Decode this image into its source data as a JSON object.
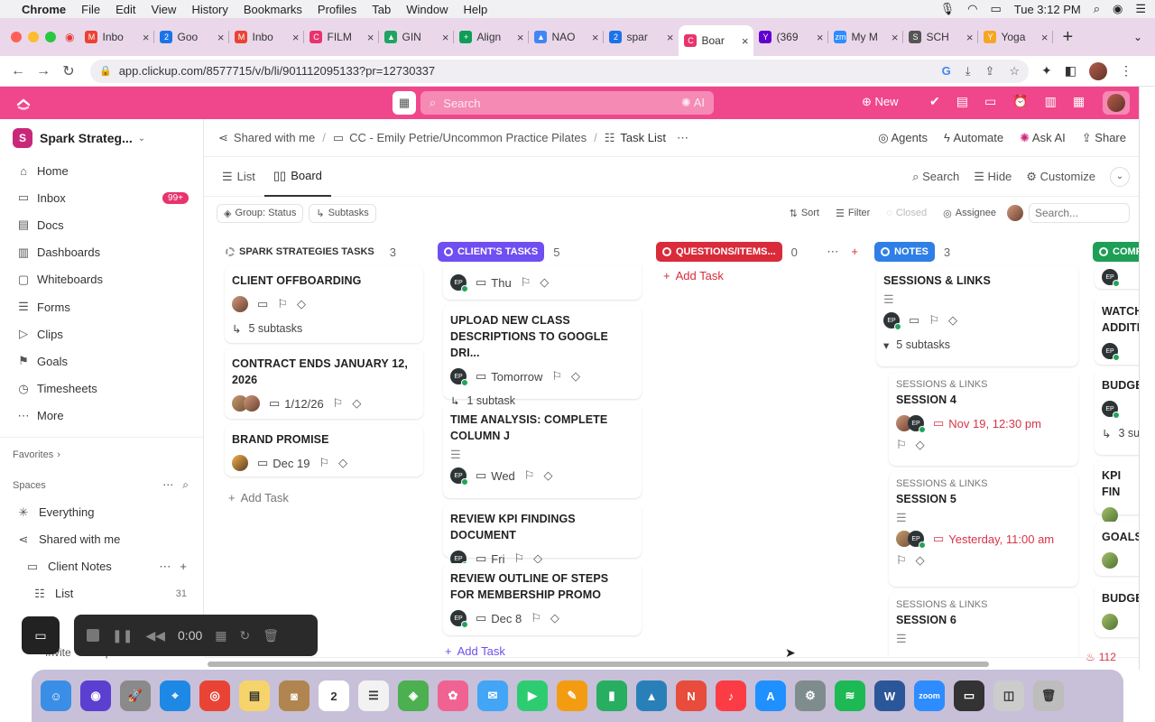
{
  "menubar": {
    "items": [
      "Chrome",
      "File",
      "Edit",
      "View",
      "History",
      "Bookmarks",
      "Profiles",
      "Tab",
      "Window",
      "Help"
    ],
    "clock": "Tue 3:12 PM"
  },
  "tabs": [
    {
      "label": "Inbo",
      "fav": "M",
      "color": "#ea4335"
    },
    {
      "label": "Goo",
      "fav": "2",
      "color": "#1a73e8"
    },
    {
      "label": "Inbo",
      "fav": "M",
      "color": "#ea4335"
    },
    {
      "label": "FILM",
      "fav": "C",
      "color": "#e8336e"
    },
    {
      "label": "GIN",
      "fav": "▲",
      "color": "#1fa463"
    },
    {
      "label": "Align",
      "fav": "+",
      "color": "#0f9d58"
    },
    {
      "label": "NAO",
      "fav": "▲",
      "color": "#4285f4"
    },
    {
      "label": "spar",
      "fav": "2",
      "color": "#1a73e8"
    },
    {
      "label": "Boar",
      "fav": "C",
      "color": "#e8336e"
    },
    {
      "label": "(369",
      "fav": "Y",
      "color": "#6001d2"
    },
    {
      "label": "My M",
      "fav": "zm",
      "color": "#2d8cff"
    },
    {
      "label": "SCH",
      "fav": "S",
      "color": "#555555"
    },
    {
      "label": "Yoga",
      "fav": "Y",
      "color": "#f5a623"
    }
  ],
  "address": {
    "url": "app.clickup.com/8577715/v/b/li/901112095133?pr=12730337"
  },
  "clickup_header": {
    "search_placeholder": "Search",
    "ai_label": "AI",
    "new_label": "New",
    "accent": "#f0478c"
  },
  "sidebar": {
    "workspace_initial": "S",
    "workspace_name": "Spark Strateg...",
    "nav": [
      {
        "label": "Home",
        "icon": "home-icon",
        "glyph": "⌂"
      },
      {
        "label": "Inbox",
        "icon": "inbox-icon",
        "glyph": "▭",
        "count": "99+"
      },
      {
        "label": "Docs",
        "icon": "docs-icon",
        "glyph": "▤"
      },
      {
        "label": "Dashboards",
        "icon": "dashboards-icon",
        "glyph": "▥"
      },
      {
        "label": "Whiteboards",
        "icon": "whiteboards-icon",
        "glyph": "▢"
      },
      {
        "label": "Forms",
        "icon": "forms-icon",
        "glyph": "☰"
      },
      {
        "label": "Clips",
        "icon": "clips-icon",
        "glyph": "▷"
      },
      {
        "label": "Goals",
        "icon": "goals-icon",
        "glyph": "⚑"
      },
      {
        "label": "Timesheets",
        "icon": "timesheets-icon",
        "glyph": "◷"
      },
      {
        "label": "More",
        "icon": "more-icon",
        "glyph": "⋯"
      }
    ],
    "favorites_label": "Favorites",
    "spaces_label": "Spaces",
    "everything_label": "Everything",
    "shared_label": "Shared with me",
    "folder_label": "Client Notes",
    "list_label": "List",
    "list_count": "31",
    "footer_invite": "Invite",
    "footer_help": "Help"
  },
  "breadcrumb": {
    "shared": "Shared with me",
    "folder": "CC - Emily Petrie/Uncommon Practice Pilates",
    "list": "Task List",
    "agents": "Agents",
    "automate": "Automate",
    "ask_ai": "Ask AI",
    "share": "Share"
  },
  "views": {
    "list": "List",
    "board": "Board",
    "search": "Search",
    "hide": "Hide",
    "customize": "Customize"
  },
  "filters": {
    "group": "Group: Status",
    "subtasks": "Subtasks",
    "sort": "Sort",
    "filter": "Filter",
    "closed": "Closed",
    "assignee": "Assignee",
    "search_placeholder": "Search..."
  },
  "columns": [
    {
      "name": "SPARK STRATEGIES TASKS",
      "count": "3",
      "color": "#e9e9e9",
      "pill": "#f0f0f0",
      "text": "#333333"
    },
    {
      "name": "CLIENT'S TASKS",
      "count": "5",
      "color": "#eeeaf8",
      "pill": "#6f4ef2",
      "text": "#ffffff"
    },
    {
      "name": "QUESTIONS/ITEMS...",
      "count": "0",
      "color": "#fbecec",
      "pill": "#d92b3a",
      "text": "#ffffff"
    },
    {
      "name": "NOTES",
      "count": "3",
      "color": "#e9f1fb",
      "pill": "#2f7fe6",
      "text": "#ffffff"
    },
    {
      "name": "COMP",
      "count": "",
      "color": "#eaf6ee",
      "pill": "#1e9e56",
      "text": "#ffffff"
    }
  ],
  "add_task": "Add Task",
  "cards": {
    "c1": {
      "title": "CLIENT OFFBOARDING",
      "sub": "5 subtasks"
    },
    "c2": {
      "title": "CONTRACT ENDS JANUARY 12, 2026",
      "date": "1/12/26"
    },
    "c3": {
      "title": "BRAND PROMISE",
      "date": "Dec 19"
    },
    "d0": {
      "date": "Thu"
    },
    "d1": {
      "title": "UPLOAD NEW CLASS DESCRIPTIONS TO GOOGLE DRI...",
      "date": "Tomorrow",
      "sub": "1 subtask"
    },
    "d2": {
      "title": "TIME ANALYSIS: COMPLETE COLUMN J",
      "date": "Wed"
    },
    "d3": {
      "title": "REVIEW KPI FINDINGS DOCUMENT",
      "date": "Fri"
    },
    "d4": {
      "title": "REVIEW OUTLINE OF STEPS FOR MEMBERSHIP PROMO",
      "date": "Dec 8"
    },
    "n1": {
      "title": "SESSIONS & LINKS",
      "sub": "5 subtasks"
    },
    "n2": {
      "parent": "SESSIONS & LINKS",
      "title": "SESSION 4",
      "date": "Nov 19, 12:30 pm"
    },
    "n3": {
      "parent": "SESSIONS & LINKS",
      "title": "SESSION 5",
      "date": "Yesterday, 11:00 am"
    },
    "n4": {
      "parent": "SESSIONS & LINKS",
      "title": "SESSION 6"
    },
    "e1": {
      "title": "WATCH ADDITI"
    },
    "e2": {
      "title": "BUDGE",
      "sub": "3 su"
    },
    "e3": {
      "title": "KPI FIN"
    },
    "e4": {
      "title": "GOALS"
    },
    "e5": {
      "title": "BUDGE"
    }
  },
  "assignee_initials": "EP",
  "recorder": {
    "time": "0:00"
  },
  "notifications": {
    "count": "112"
  },
  "dock": [
    {
      "name": "finder",
      "glyph": "☺",
      "color": "#3a8ee6"
    },
    {
      "name": "siri",
      "glyph": "◉",
      "color": "#5b3fd1"
    },
    {
      "name": "launchpad",
      "glyph": "🚀",
      "color": "#8a8a8a"
    },
    {
      "name": "safari",
      "glyph": "⌖",
      "color": "#1e88e5"
    },
    {
      "name": "chrome",
      "glyph": "◎",
      "color": "#e94335"
    },
    {
      "name": "notes",
      "glyph": "▤",
      "color": "#f6d46b"
    },
    {
      "name": "contacts",
      "glyph": "◙",
      "color": "#b08550"
    },
    {
      "name": "calendar",
      "glyph": "2",
      "color": "#ffffff"
    },
    {
      "name": "reminders",
      "glyph": "☰",
      "color": "#f2f2f2"
    },
    {
      "name": "maps",
      "glyph": "◈",
      "color": "#4caf50"
    },
    {
      "name": "photos",
      "glyph": "✿",
      "color": "#f06292"
    },
    {
      "name": "messages",
      "glyph": "✉",
      "color": "#42a5f5"
    },
    {
      "name": "facetime",
      "glyph": "▶",
      "color": "#2ecc71"
    },
    {
      "name": "pages",
      "glyph": "✎",
      "color": "#f39c12"
    },
    {
      "name": "numbers",
      "glyph": "▮",
      "color": "#27ae60"
    },
    {
      "name": "keynote",
      "glyph": "▲",
      "color": "#2980b9"
    },
    {
      "name": "news",
      "glyph": "N",
      "color": "#e74c3c"
    },
    {
      "name": "music",
      "glyph": "♪",
      "color": "#fc3c44"
    },
    {
      "name": "appstore",
      "glyph": "A",
      "color": "#1e90ff"
    },
    {
      "name": "settings",
      "glyph": "⚙",
      "color": "#7f8c8d"
    },
    {
      "name": "spotify",
      "glyph": "≋",
      "color": "#1db954"
    },
    {
      "name": "word",
      "glyph": "W",
      "color": "#2b579a"
    },
    {
      "name": "zoom",
      "glyph": "zoom",
      "color": "#2d8cff"
    },
    {
      "name": "screen-recorder",
      "glyph": "▭",
      "color": "#333333"
    },
    {
      "name": "preview",
      "glyph": "◫",
      "color": "#cccccc"
    },
    {
      "name": "trash",
      "glyph": "🗑",
      "color": "#bdbdbd"
    }
  ]
}
